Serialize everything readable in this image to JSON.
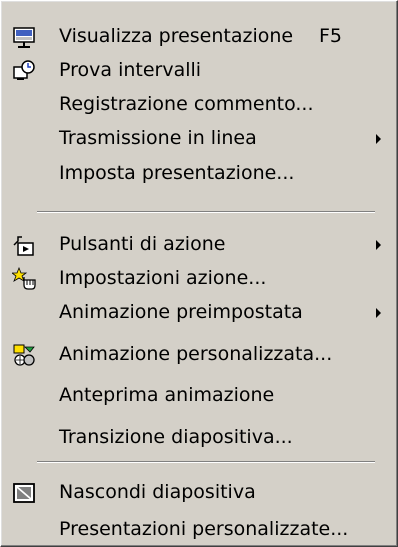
{
  "menu": {
    "items": [
      {
        "label": "Visualizza presentazione",
        "shortcut": "F5",
        "icon": "slideshow-icon",
        "submenu": false
      },
      {
        "label": "Prova intervalli",
        "icon": "rehearse-timings-icon",
        "submenu": false
      },
      {
        "label": "Registrazione commento...",
        "submenu": false
      },
      {
        "label": "Trasmissione in linea",
        "submenu": true
      },
      {
        "label": "Imposta presentazione...",
        "submenu": false
      },
      {
        "label": "Pulsanti di azione",
        "icon": "action-buttons-icon",
        "submenu": true
      },
      {
        "label": "Impostazioni azione...",
        "icon": "action-settings-icon",
        "submenu": false
      },
      {
        "label": "Animazione preimpostata",
        "submenu": true
      },
      {
        "label": "Animazione personalizzata...",
        "icon": "custom-animation-icon",
        "submenu": false
      },
      {
        "label": "Anteprima animazione",
        "submenu": false
      },
      {
        "label": "Transizione diapositiva...",
        "submenu": false
      },
      {
        "label": "Nascondi diapositiva",
        "icon": "hide-slide-icon",
        "submenu": false
      },
      {
        "label": "Presentazioni personalizzate...",
        "submenu": false
      }
    ]
  },
  "colors": {
    "menu_bg": "#d4d0c8",
    "separator_dark": "#808080",
    "separator_light": "#ffffff"
  }
}
